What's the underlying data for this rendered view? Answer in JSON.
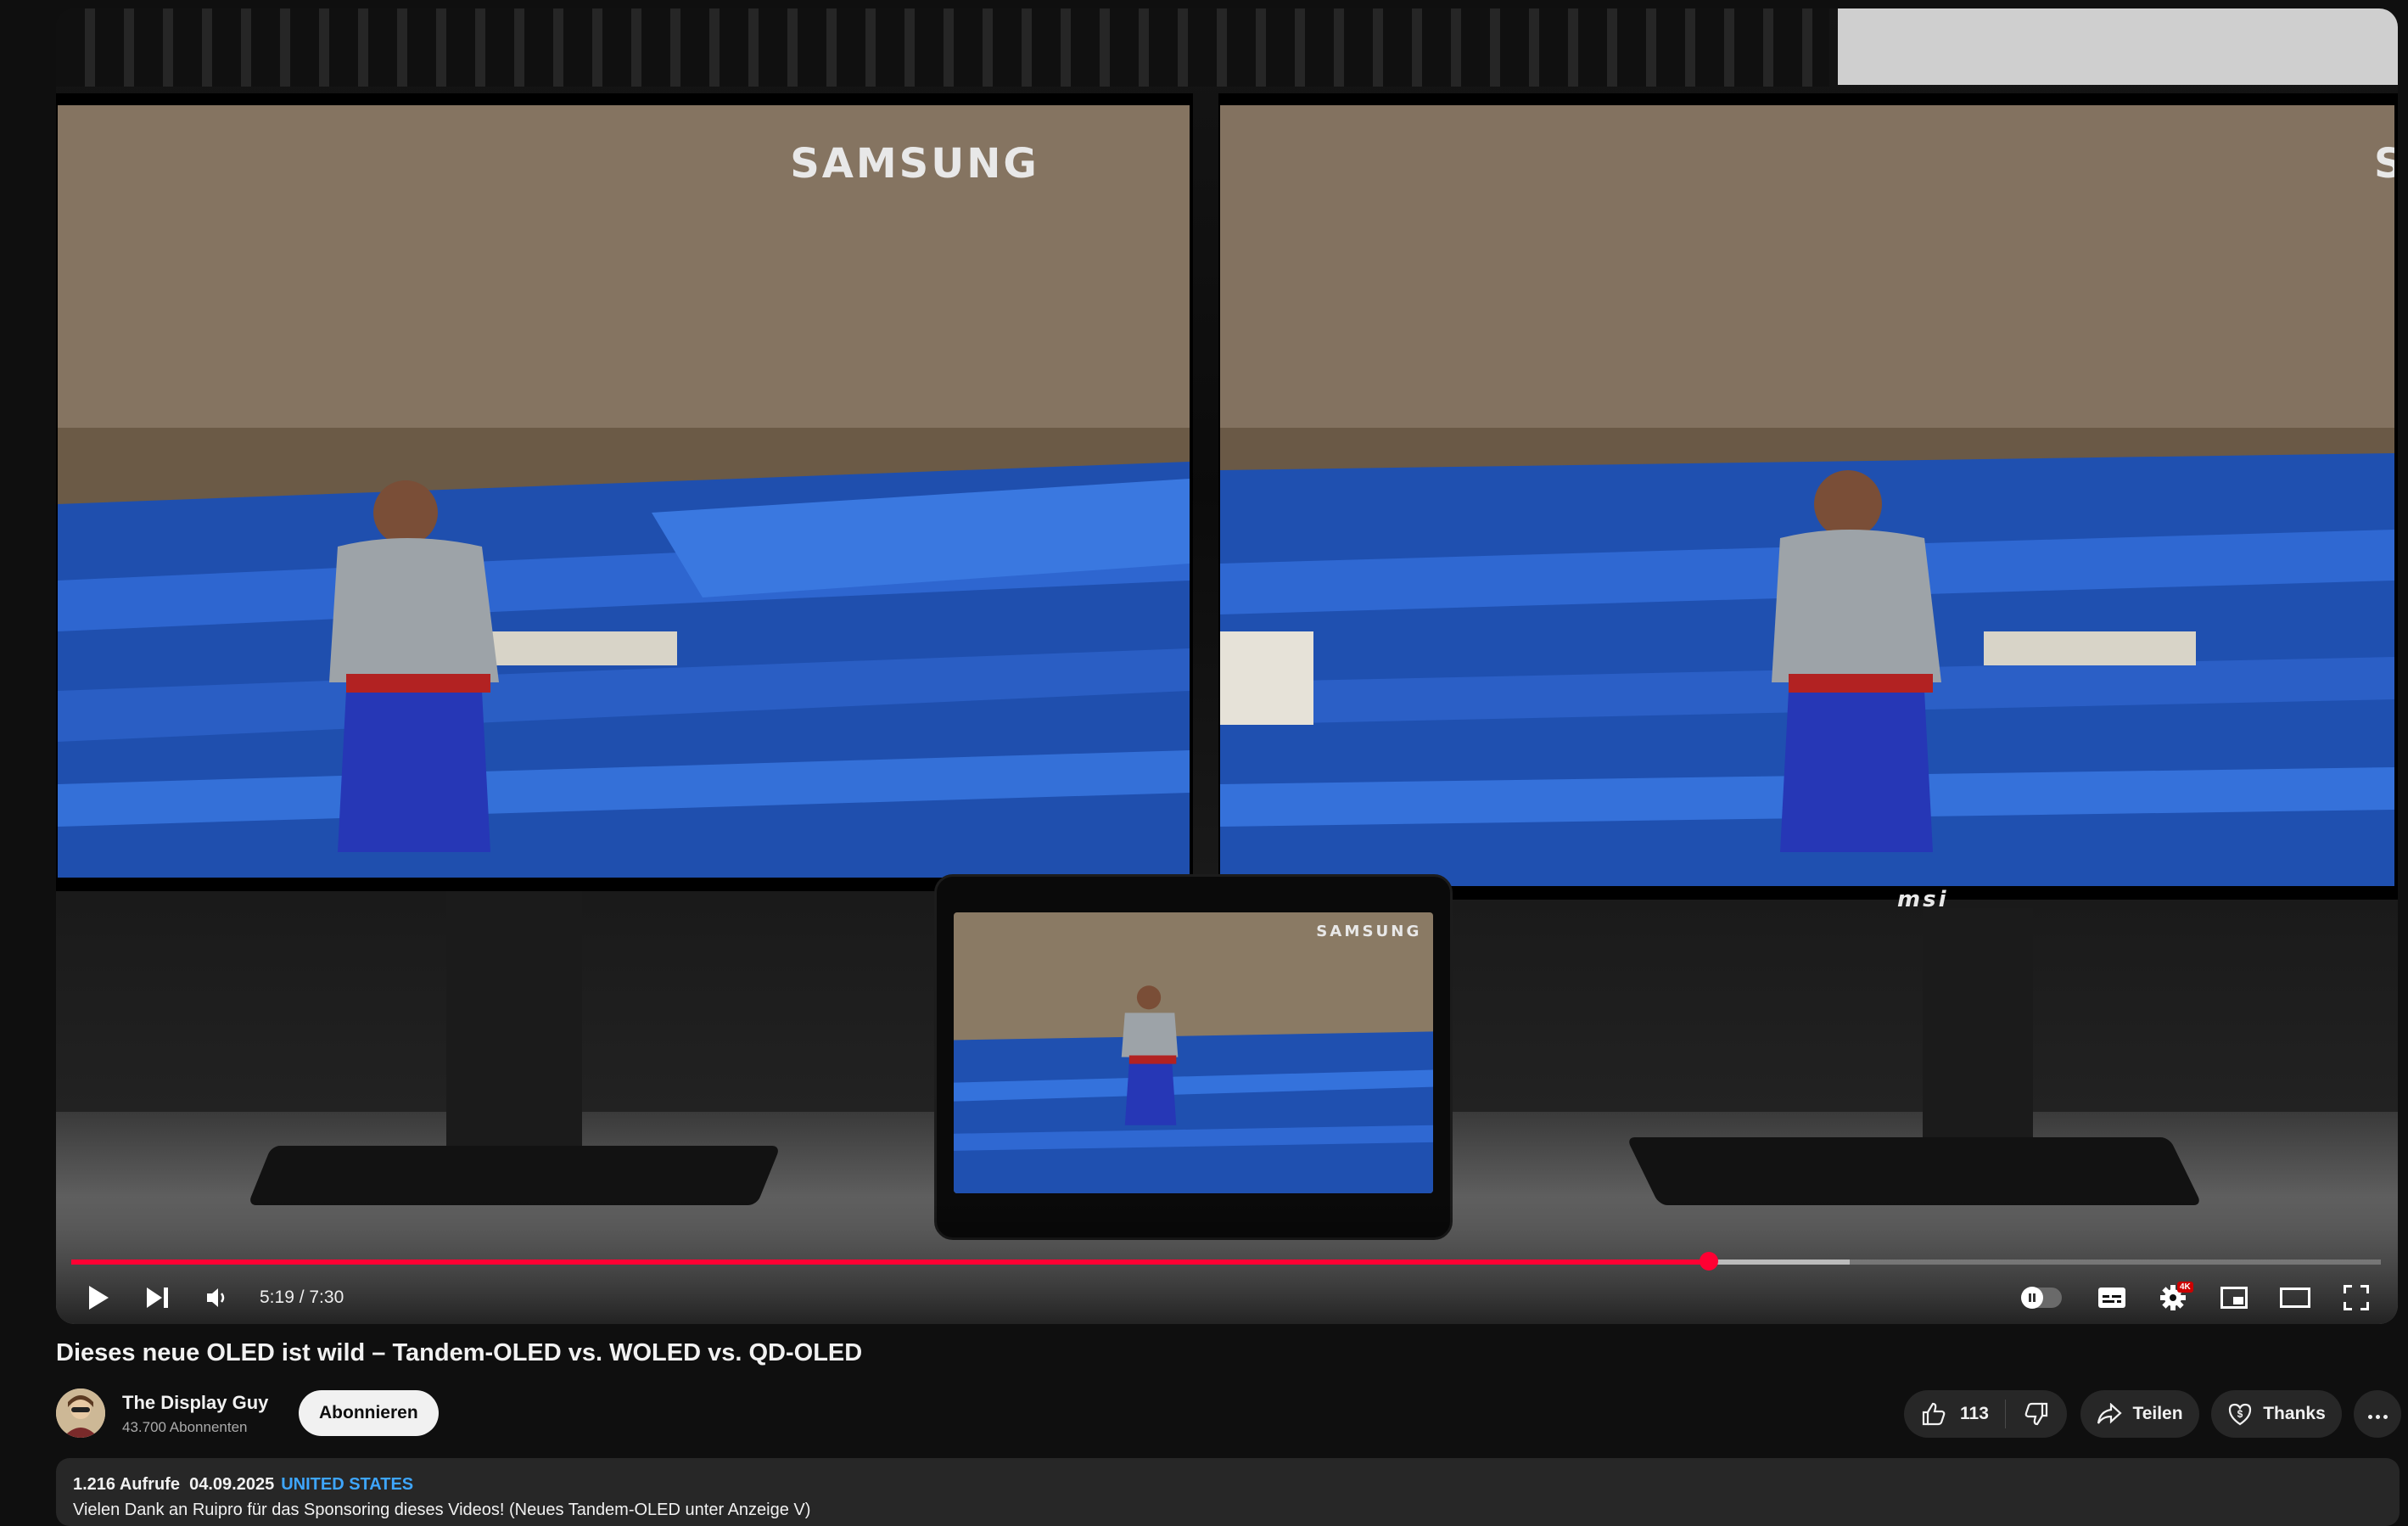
{
  "video": {
    "current_time": "5:19",
    "duration": "7:30",
    "time_display": "5:19 / 7:30",
    "played_fraction": 0.709,
    "buffered_fraction": 0.77,
    "quality_badge": "4K",
    "screen_brand": "SAMSUNG",
    "monitor_brand": "msi"
  },
  "meta": {
    "title": "Dieses neue OLED ist wild – Tandem-OLED vs. WOLED vs. QD-OLED"
  },
  "channel": {
    "name": "The Display Guy",
    "subscribers": "43.700 Abonnenten",
    "subscribe_label": "Abonnieren"
  },
  "actions": {
    "like_count": "113",
    "share_label": "Teilen",
    "thanks_label": "Thanks"
  },
  "description": {
    "views": "1.216 Aufrufe",
    "date": "04.09.2025",
    "location_tag": "UNITED STATES",
    "first_line": "Vielen Dank an Ruipro für das Sponsoring dieses Videos! (Neues Tandem-OLED unter Anzeige V)"
  },
  "icons": [
    "play-icon",
    "next-icon",
    "volume-icon",
    "autoplay-toggle-icon",
    "subtitles-icon",
    "settings-icon",
    "miniplayer-icon",
    "theater-icon",
    "fullscreen-icon",
    "like-icon",
    "dislike-icon",
    "share-icon",
    "thanks-icon",
    "more-icon"
  ],
  "colors": {
    "accent_red": "#ff0033",
    "link_blue": "#3ea6ff",
    "page_bg": "#0f0f0f"
  }
}
